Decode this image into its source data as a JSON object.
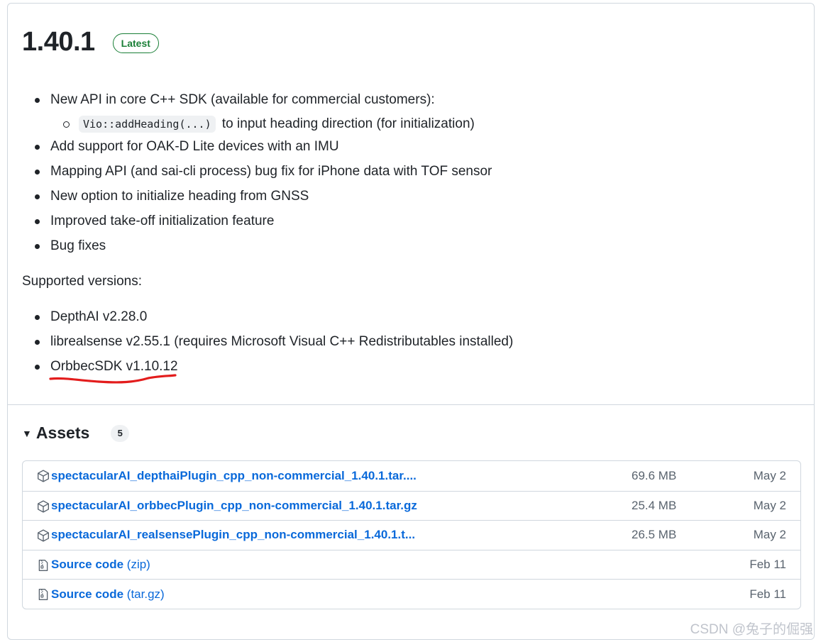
{
  "release": {
    "version": "1.40.1",
    "badge": "Latest",
    "notes": [
      "New API in core C++ SDK (available for commercial customers):",
      "Add support for OAK-D Lite devices with an IMU",
      "Mapping API (and sai-cli process) bug fix for iPhone data with TOF sensor",
      "New option to initialize heading from GNSS",
      "Improved take-off initialization feature",
      "Bug fixes"
    ],
    "subnote": {
      "code": "Vio::addHeading(...)",
      "text": "to input heading direction (for initialization)"
    },
    "supported_label": "Supported versions:",
    "supported": [
      "DepthAI v2.28.0",
      "librealsense v2.55.1 (requires Microsoft Visual C++ Redistributables installed)",
      "OrbbecSDK v1.10.12"
    ],
    "annotation_color": "#e31c1c"
  },
  "assets": {
    "title": "Assets",
    "count": "5",
    "items": [
      {
        "name": "spectacularAI_depthaiPlugin_cpp_non-commercial_1.40.1.tar....",
        "suffix": "",
        "size": "69.6 MB",
        "date": "May 2",
        "icon": "package-icon"
      },
      {
        "name": "spectacularAI_orbbecPlugin_cpp_non-commercial_1.40.1.tar.gz",
        "suffix": "",
        "size": "25.4 MB",
        "date": "May 2",
        "icon": "package-icon"
      },
      {
        "name": "spectacularAI_realsensePlugin_cpp_non-commercial_1.40.1.t...",
        "suffix": "",
        "size": "26.5 MB",
        "date": "May 2",
        "icon": "package-icon"
      },
      {
        "name": "Source code",
        "suffix": "(zip)",
        "size": "",
        "date": "Feb 11",
        "icon": "file-zip-icon"
      },
      {
        "name": "Source code",
        "suffix": "(tar.gz)",
        "size": "",
        "date": "Feb 11",
        "icon": "file-zip-icon"
      }
    ],
    "link_color": "#0969da"
  },
  "watermark": "CSDN @兔子的倔强"
}
